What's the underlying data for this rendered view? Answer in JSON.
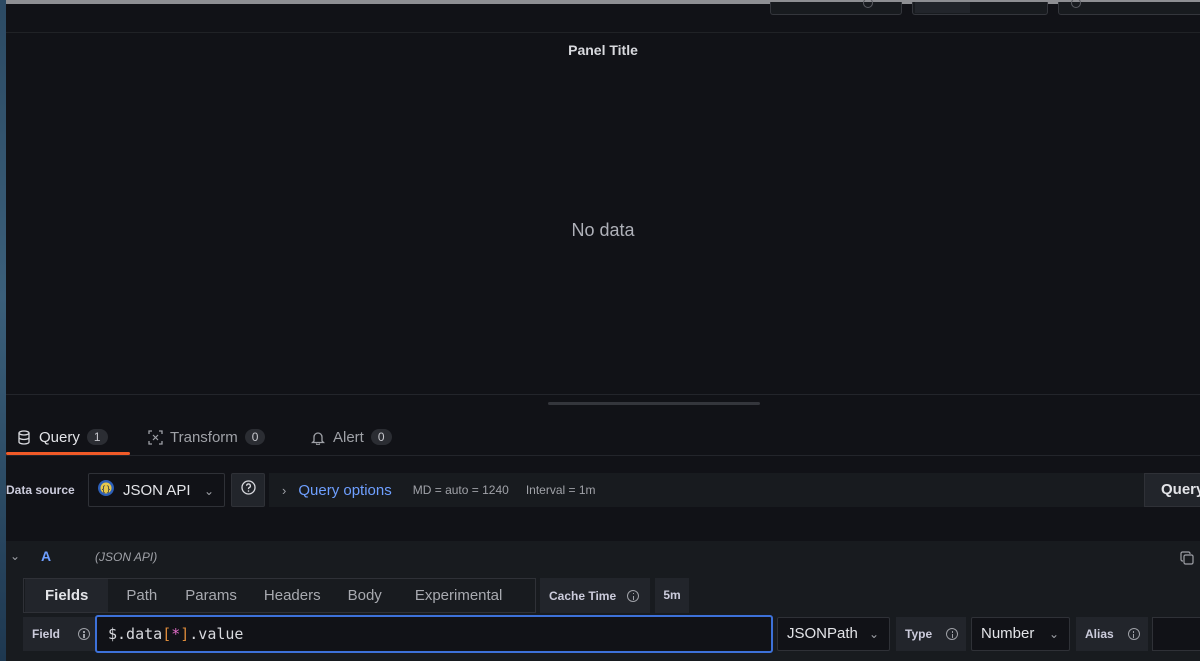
{
  "panel": {
    "title": "Panel Title",
    "empty_text": "No data"
  },
  "editor_tabs": [
    {
      "label": "Query",
      "count": "1",
      "icon": "database-icon"
    },
    {
      "label": "Transform",
      "count": "0",
      "icon": "transform-icon"
    },
    {
      "label": "Alert",
      "count": "0",
      "icon": "bell-icon"
    }
  ],
  "datasource": {
    "label": "Data source",
    "selected": "JSON API",
    "icon": "json-api-logo-icon"
  },
  "query_options": {
    "title": "Query options",
    "max_data_points": "MD = auto = 1240",
    "interval": "Interval = 1m"
  },
  "run_button": "Query",
  "query": {
    "ref_id": "A",
    "datasource_name": "(JSON API)"
  },
  "subtabs": [
    "Fields",
    "Path",
    "Params",
    "Headers",
    "Body",
    "Experimental"
  ],
  "cache": {
    "label": "Cache Time",
    "value": "5m"
  },
  "field_row": {
    "label": "Field",
    "expression_prefix": "$.data",
    "expression_open": "[",
    "expression_star": "*",
    "expression_close": "]",
    "expression_suffix": ".value",
    "language": "JSONPath",
    "type_label": "Type",
    "type_value": "Number",
    "alias_label": "Alias",
    "alias_value": ""
  },
  "colors": {
    "background": "#111217",
    "accent_tab": "#f05a28",
    "link_blue": "#6e9fff",
    "focus_border": "#3d71d9"
  }
}
